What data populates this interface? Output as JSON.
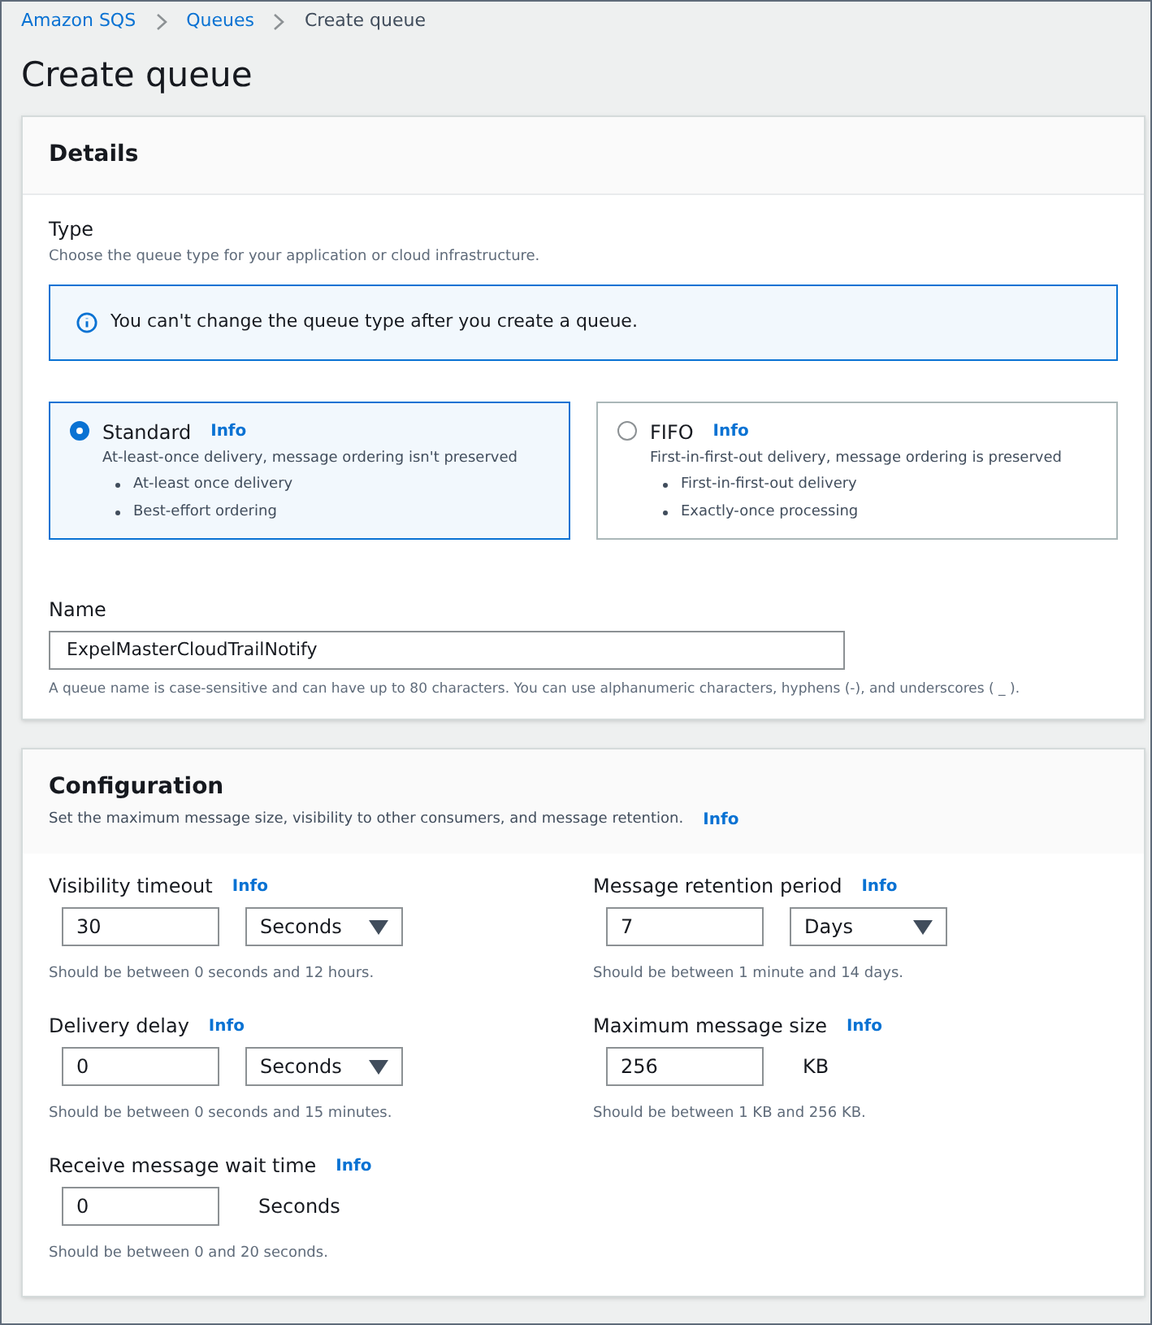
{
  "breadcrumb": [
    {
      "label": "Amazon SQS",
      "kind": "link"
    },
    {
      "label": "Queues",
      "kind": "link"
    },
    {
      "label": "Create queue",
      "kind": "current"
    }
  ],
  "page_title": "Create queue",
  "details": {
    "title": "Details",
    "type_label": "Type",
    "type_description": "Choose the queue type for your application or cloud infrastructure.",
    "alert": "You can't change the queue type after you create a queue.",
    "queue_types": [
      {
        "name": "Standard",
        "info": "Info",
        "description": "At-least-once delivery, message ordering isn't preserved",
        "bullets": [
          "At-least once delivery",
          "Best-effort ordering"
        ],
        "selected": true
      },
      {
        "name": "FIFO",
        "info": "Info",
        "description": "First-in-first-out delivery, message ordering is preserved",
        "bullets": [
          "First-in-first-out delivery",
          "Exactly-once processing"
        ],
        "selected": false
      }
    ],
    "name_label": "Name",
    "name_value": "ExpelMasterCloudTrailNotify",
    "name_hint": "A queue name is case-sensitive and can have up to 80 characters. You can use alphanumeric characters, hyphens (-), and underscores ( _ )."
  },
  "configuration": {
    "title": "Configuration",
    "description": "Set the maximum message size, visibility to other consumers, and message retention.",
    "info": "Info",
    "fields": [
      {
        "label": "Visibility timeout",
        "info": "Info",
        "value": "30",
        "kind": "select",
        "unit": "Seconds",
        "hint": "Should be between 0 seconds and 12 hours."
      },
      {
        "label": "Message retention period",
        "info": "Info",
        "value": "7",
        "kind": "select",
        "unit": "Days",
        "hint": "Should be between 1 minute and 14 days."
      },
      {
        "label": "Delivery delay",
        "info": "Info",
        "value": "0",
        "kind": "select",
        "unit": "Seconds",
        "hint": "Should be between 0 seconds and 15 minutes."
      },
      {
        "label": "Maximum message size",
        "info": "Info",
        "value": "256",
        "kind": "unit",
        "unit": "KB",
        "hint": "Should be between 1 KB and 256 KB."
      },
      {
        "label": "Receive message wait time",
        "info": "Info",
        "value": "0",
        "kind": "unit",
        "unit": "Seconds",
        "hint": "Should be between 0 and 20 seconds."
      }
    ]
  }
}
